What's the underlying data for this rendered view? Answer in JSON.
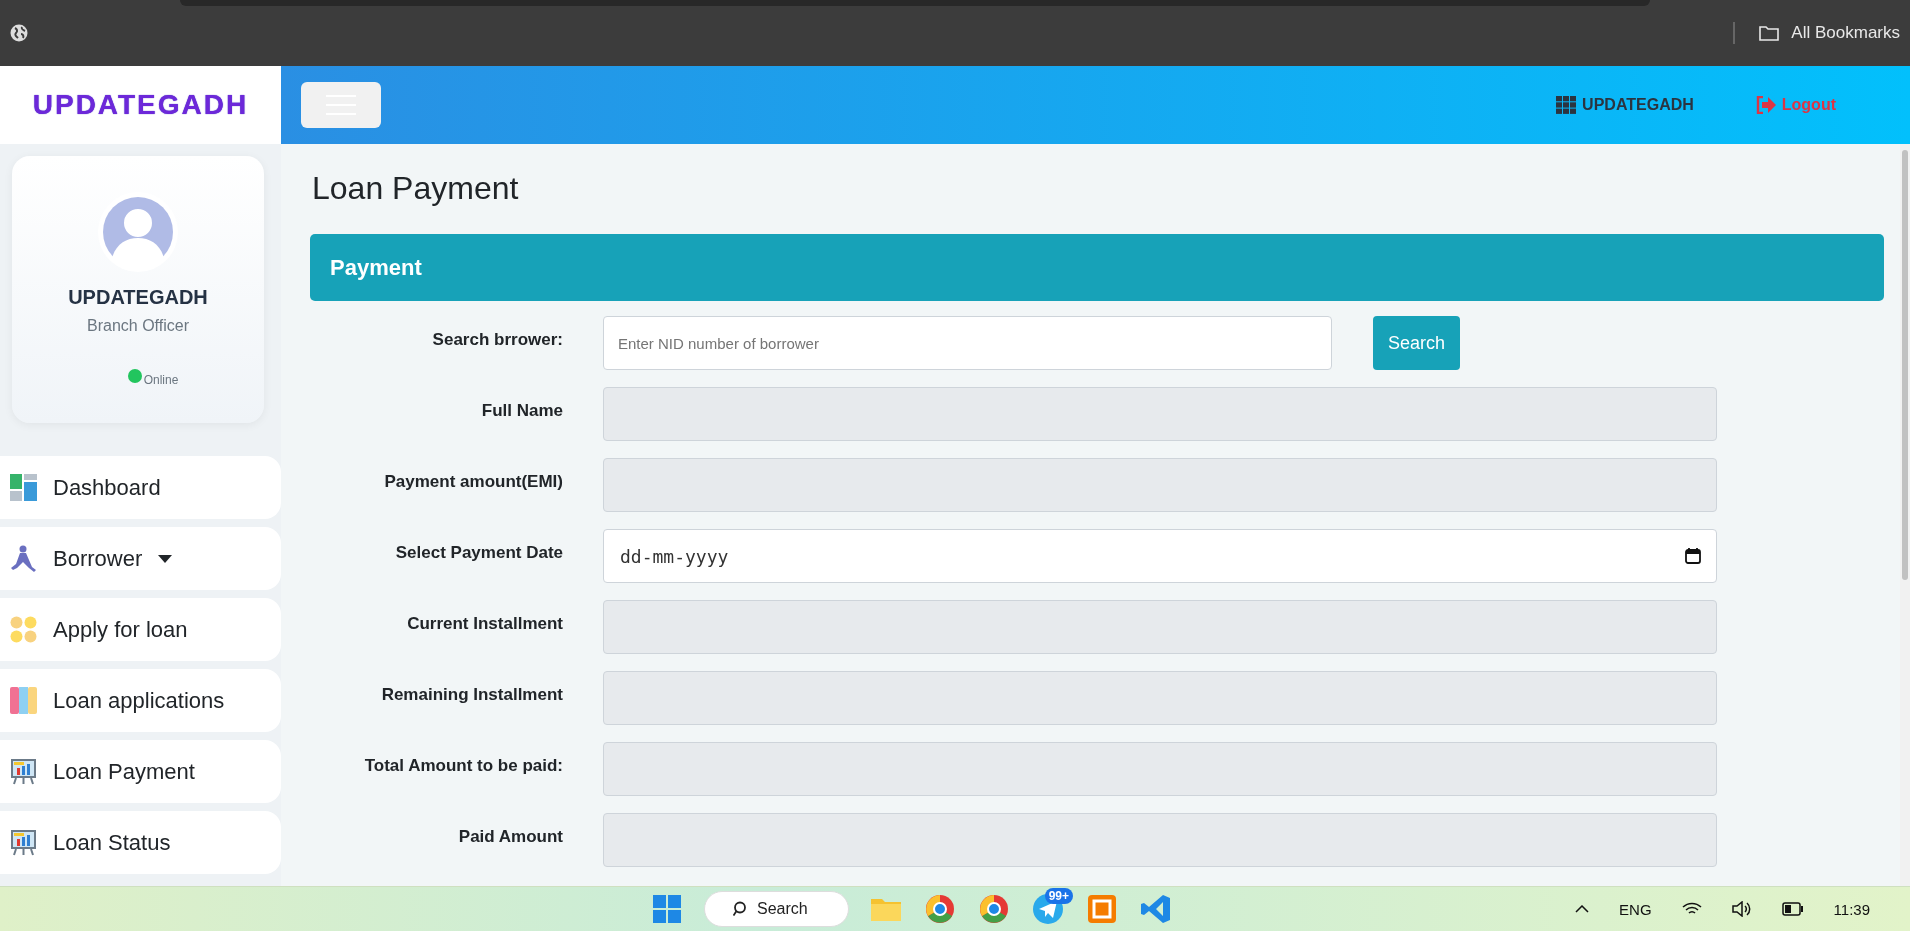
{
  "browser": {
    "bookmarks_label": "All Bookmarks"
  },
  "header": {
    "logo": "UPDATEGADH",
    "user_link": "UPDATEGADH",
    "logout": "Logout"
  },
  "profile": {
    "name": "UPDATEGADH",
    "role": "Branch Officer",
    "online": true,
    "status": "Online"
  },
  "sidebar": {
    "items": [
      {
        "label": "Dashboard",
        "kind": "tiles",
        "dropdown": false
      },
      {
        "label": "Borrower",
        "kind": "person",
        "dropdown": true
      },
      {
        "label": "Apply for loan",
        "kind": "circles",
        "dropdown": false
      },
      {
        "label": "Loan applications",
        "kind": "columns",
        "dropdown": false
      },
      {
        "label": "Loan Payment",
        "kind": "board",
        "dropdown": false
      },
      {
        "label": "Loan Status",
        "kind": "board",
        "dropdown": false
      }
    ]
  },
  "page": {
    "title": "Loan Payment",
    "card_title": "Payment",
    "fields": [
      {
        "label": "Search brrower:",
        "kind": "search",
        "placeholder": "Enter NID number of borrower",
        "button": "Search"
      },
      {
        "label": "Full Name",
        "kind": "readonly"
      },
      {
        "label": "Payment amount(EMI)",
        "kind": "readonly"
      },
      {
        "label": "Select Payment Date",
        "kind": "date",
        "placeholder": "dd-mm-yyyy"
      },
      {
        "label": "Current Installment",
        "kind": "readonly"
      },
      {
        "label": "Remaining Installment",
        "kind": "readonly"
      },
      {
        "label": "Total Amount to be paid:",
        "kind": "readonly"
      },
      {
        "label": "Paid Amount",
        "kind": "readonly"
      }
    ]
  },
  "taskbar": {
    "search": "Search",
    "badge": "99+",
    "language": "ENG",
    "time": "11:39"
  }
}
